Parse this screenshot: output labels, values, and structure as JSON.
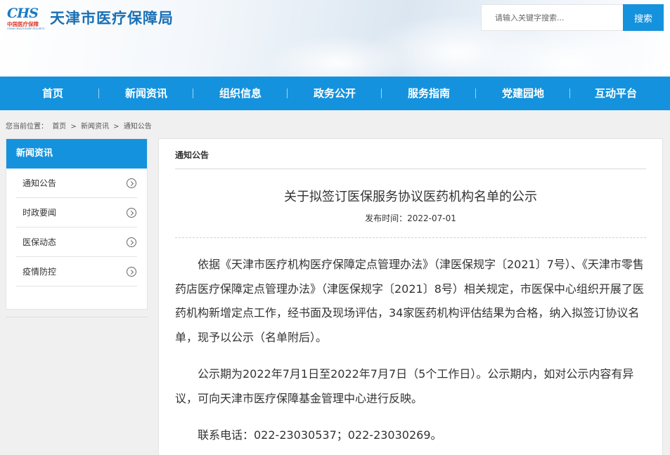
{
  "header": {
    "logo_mark": "CHS",
    "logo_cn": "中国医疗保障",
    "logo_en": "CHINA HEALTHCARE SECURITY",
    "site_title": "天津市医疗保障局",
    "search_placeholder": "请输入关键字搜索...",
    "search_button": "搜索"
  },
  "nav": {
    "items": [
      "首页",
      "新闻资讯",
      "组织信息",
      "政务公开",
      "服务指南",
      "党建园地",
      "互动平台"
    ]
  },
  "breadcrumb": {
    "prefix": "您当前位置：",
    "items": [
      "首页",
      ">",
      "新闻资讯",
      ">",
      "通知公告"
    ]
  },
  "sidebar": {
    "title": "新闻资讯",
    "items": [
      "通知公告",
      "时政要闻",
      "医保动态",
      "疫情防控"
    ]
  },
  "main": {
    "section_title": "通知公告",
    "article_title": "关于拟签订医保服务协议医药机构名单的公示",
    "article_date": "发布时间：2022-07-01",
    "paragraphs": [
      "依据《天津市医疗机构医疗保障定点管理办法》（津医保规字〔2021〕7号）、《天津市零售药店医疗保障定点管理办法》（津医保规字〔2021〕8号）相关规定，市医保中心组织开展了医药机构新增定点工作，经书面及现场评估，34家医药机构评估结果为合格，纳入拟签订协议名单，现予以公示（名单附后）。",
      "公示期为2022年7月1日至2022年7月7日（5个工作日）。公示期内，如对公示内容有异议，可向天津市医疗保障基金管理中心进行反映。",
      "联系电话：022-23030537；022-23030269。"
    ]
  },
  "colors": {
    "primary_blue": "#1592dd",
    "title_blue": "#1a6fb5",
    "logo_red": "#e03a2e"
  }
}
